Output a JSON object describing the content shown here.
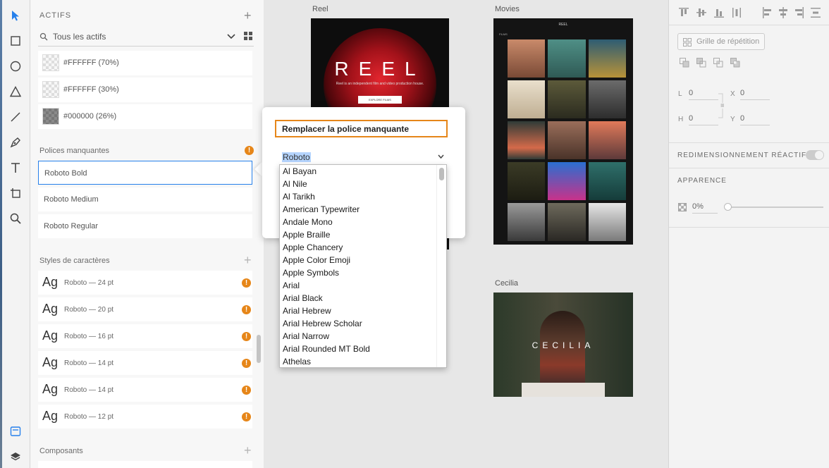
{
  "assets_panel": {
    "title": "ACTIFS",
    "search_label": "Tous les actifs",
    "colors": [
      {
        "label": "#FFFFFF (70%)",
        "swatch": "light"
      },
      {
        "label": "#FFFFFF (30%)",
        "swatch": "light"
      },
      {
        "label": "#000000 (26%)",
        "swatch": "dark"
      }
    ],
    "missing_fonts_label": "Polices manquantes",
    "missing_fonts": [
      "Roboto Bold",
      "Roboto Medium",
      "Roboto Regular"
    ],
    "char_styles_label": "Styles de caractères",
    "char_styles": [
      {
        "sample": "Ag",
        "label": "Roboto — 24 pt"
      },
      {
        "sample": "Ag",
        "label": "Roboto — 20 pt"
      },
      {
        "sample": "Ag",
        "label": "Roboto — 16 pt"
      },
      {
        "sample": "Ag",
        "label": "Roboto — 14 pt"
      },
      {
        "sample": "Ag",
        "label": "Roboto — 14 pt"
      },
      {
        "sample": "Ag",
        "label": "Roboto — 12 pt"
      }
    ],
    "components_label": "Composants"
  },
  "canvas": {
    "artboards": [
      {
        "label": "Reel",
        "hero_text": "REEL",
        "tagline": "Reel is an independent film and video production house.",
        "button": "EXPLORE FILMS"
      },
      {
        "label": "Movies",
        "logo": "REEL",
        "nav": "FILMS"
      },
      {
        "label": "Cecilia",
        "hero_text": "CECILIA"
      }
    ]
  },
  "dialog": {
    "title": "Remplacer la police manquante",
    "selected_font": "Roboto",
    "options": [
      "Al Bayan",
      "Al Nile",
      "Al Tarikh",
      "American Typewriter",
      "Andale Mono",
      "Apple Braille",
      "Apple Chancery",
      "Apple Color Emoji",
      "Apple Symbols",
      "Arial",
      "Arial Black",
      "Arial Hebrew",
      "Arial Hebrew Scholar",
      "Arial Narrow",
      "Arial Rounded MT Bold",
      "Athelas"
    ]
  },
  "properties": {
    "repeat_grid": "Grille de répétition",
    "w_label": "L",
    "w_value": "0",
    "h_label": "H",
    "h_value": "0",
    "x_label": "X",
    "x_value": "0",
    "y_label": "Y",
    "y_value": "0",
    "responsive_label": "REDIMENSIONNEMENT RÉACTIF",
    "appearance_label": "APPARENCE",
    "opacity_value": "0%"
  },
  "colors": {
    "accent_blue": "#2680eb",
    "warning": "#e68619"
  }
}
